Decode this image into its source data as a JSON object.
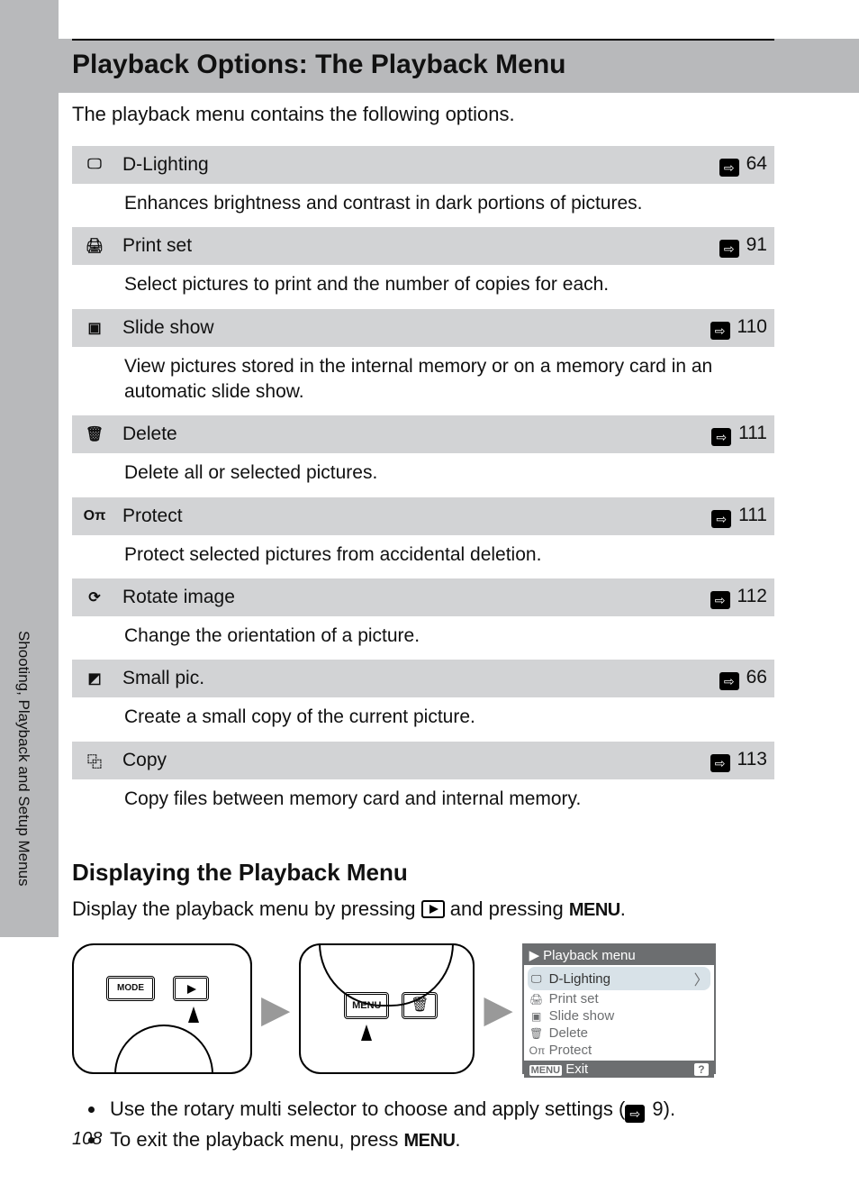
{
  "page": {
    "h1": "Playback Options: The Playback Menu",
    "intro": "The playback menu contains the following options.",
    "h2": "Displaying the Playback Menu",
    "display_text_pre": "Display the playback menu by pressing ",
    "display_text_mid": " and pressing ",
    "display_text_post": ".",
    "menu_word": "MENU",
    "bullet1_pre": "Use the rotary multi selector to choose and apply settings (",
    "bullet1_ref": "9",
    "bullet1_post": ").",
    "bullet2_pre": "To exit the playback menu, press ",
    "bullet2_post": ".",
    "side_tab": "Shooting, Playback and Setup Menus",
    "page_number": "108"
  },
  "options": [
    {
      "icon": "🖵",
      "title": "D-Lighting",
      "ref": "64",
      "desc": "Enhances brightness and contrast in dark portions of pictures."
    },
    {
      "icon": "🖨",
      "title": "Print set",
      "ref": "91",
      "desc": "Select pictures to print and the number of copies for each."
    },
    {
      "icon": "▣",
      "title": "Slide show",
      "ref": "110",
      "desc": "View pictures stored in the internal memory or on a memory card in an automatic slide show."
    },
    {
      "icon": "🗑",
      "title": "Delete",
      "ref": "111",
      "desc": "Delete all or selected pictures."
    },
    {
      "icon": "Oπ",
      "title": "Protect",
      "ref": "111",
      "desc": "Protect selected pictures from accidental deletion."
    },
    {
      "icon": "⟳",
      "title": "Rotate image",
      "ref": "112",
      "desc": "Change the orientation of a picture."
    },
    {
      "icon": "◩",
      "title": "Small pic.",
      "ref": "66",
      "desc": "Create a small copy of the current picture."
    },
    {
      "icon": "⿻",
      "title": "Copy",
      "ref": "113",
      "desc": "Copy files between memory card and internal memory."
    }
  ],
  "diagram": {
    "mode_label": "MODE",
    "menu_label": "MENU"
  },
  "screen": {
    "title": "Playback menu",
    "items": [
      {
        "icon": "🖵",
        "label": "D-Lighting",
        "selected": true
      },
      {
        "icon": "🖨",
        "label": "Print set",
        "selected": false
      },
      {
        "icon": "▣",
        "label": "Slide show",
        "selected": false
      },
      {
        "icon": "🗑",
        "label": "Delete",
        "selected": false
      },
      {
        "icon": "Oπ",
        "label": "Protect",
        "selected": false
      }
    ],
    "footer_menu": "MENU",
    "footer_exit": "Exit",
    "footer_help": "?"
  }
}
